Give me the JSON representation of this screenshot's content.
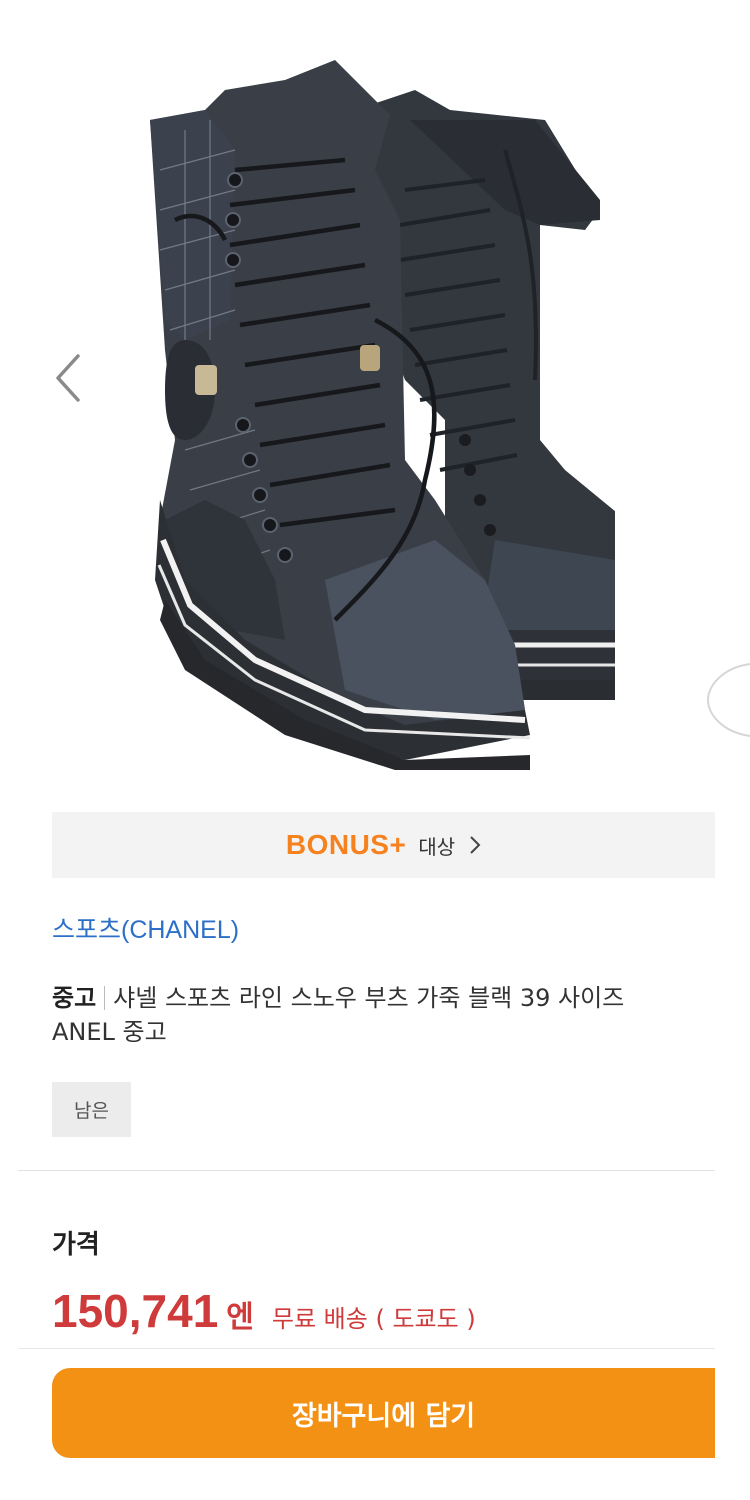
{
  "gallery": {
    "image_icon": "lace-up-boots-image",
    "prev_icon": "chevron-left-icon"
  },
  "bonus": {
    "logo": "BONUS+",
    "target": "대상",
    "chevron_icon": "chevron-right-icon",
    "accent": "#f5821f"
  },
  "brand": {
    "link": "스포츠(CHANEL)"
  },
  "title": {
    "condition": "중고",
    "line1": "샤넬 스포츠 라인 스노우 부츠 가죽 블랙 39 사이즈",
    "line2": "ANEL 중고"
  },
  "tag": "남은",
  "price": {
    "label": "가격",
    "value": "150,741",
    "unit": "엔",
    "shipping": "무료 배송 ( 도쿄도 )",
    "color": "#cf3a3a"
  },
  "cart": {
    "label": "장바구니에 담기",
    "color": "#f39115"
  }
}
